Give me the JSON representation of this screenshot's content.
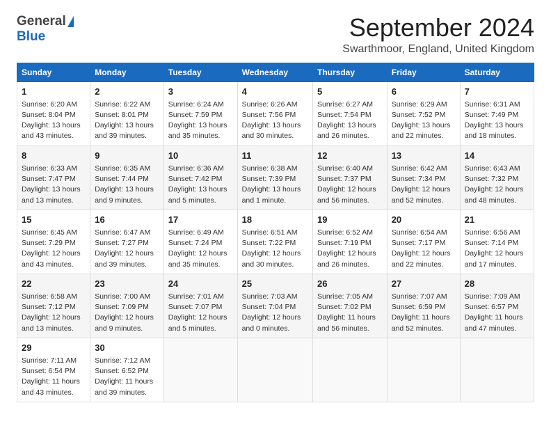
{
  "header": {
    "logo_general": "General",
    "logo_blue": "Blue",
    "month_title": "September 2024",
    "location": "Swarthmoor, England, United Kingdom"
  },
  "weekdays": [
    "Sunday",
    "Monday",
    "Tuesday",
    "Wednesday",
    "Thursday",
    "Friday",
    "Saturday"
  ],
  "weeks": [
    [
      {
        "day": "1",
        "sunrise": "Sunrise: 6:20 AM",
        "sunset": "Sunset: 8:04 PM",
        "daylight": "Daylight: 13 hours and 43 minutes."
      },
      {
        "day": "2",
        "sunrise": "Sunrise: 6:22 AM",
        "sunset": "Sunset: 8:01 PM",
        "daylight": "Daylight: 13 hours and 39 minutes."
      },
      {
        "day": "3",
        "sunrise": "Sunrise: 6:24 AM",
        "sunset": "Sunset: 7:59 PM",
        "daylight": "Daylight: 13 hours and 35 minutes."
      },
      {
        "day": "4",
        "sunrise": "Sunrise: 6:26 AM",
        "sunset": "Sunset: 7:56 PM",
        "daylight": "Daylight: 13 hours and 30 minutes."
      },
      {
        "day": "5",
        "sunrise": "Sunrise: 6:27 AM",
        "sunset": "Sunset: 7:54 PM",
        "daylight": "Daylight: 13 hours and 26 minutes."
      },
      {
        "day": "6",
        "sunrise": "Sunrise: 6:29 AM",
        "sunset": "Sunset: 7:52 PM",
        "daylight": "Daylight: 13 hours and 22 minutes."
      },
      {
        "day": "7",
        "sunrise": "Sunrise: 6:31 AM",
        "sunset": "Sunset: 7:49 PM",
        "daylight": "Daylight: 13 hours and 18 minutes."
      }
    ],
    [
      {
        "day": "8",
        "sunrise": "Sunrise: 6:33 AM",
        "sunset": "Sunset: 7:47 PM",
        "daylight": "Daylight: 13 hours and 13 minutes."
      },
      {
        "day": "9",
        "sunrise": "Sunrise: 6:35 AM",
        "sunset": "Sunset: 7:44 PM",
        "daylight": "Daylight: 13 hours and 9 minutes."
      },
      {
        "day": "10",
        "sunrise": "Sunrise: 6:36 AM",
        "sunset": "Sunset: 7:42 PM",
        "daylight": "Daylight: 13 hours and 5 minutes."
      },
      {
        "day": "11",
        "sunrise": "Sunrise: 6:38 AM",
        "sunset": "Sunset: 7:39 PM",
        "daylight": "Daylight: 13 hours and 1 minute."
      },
      {
        "day": "12",
        "sunrise": "Sunrise: 6:40 AM",
        "sunset": "Sunset: 7:37 PM",
        "daylight": "Daylight: 12 hours and 56 minutes."
      },
      {
        "day": "13",
        "sunrise": "Sunrise: 6:42 AM",
        "sunset": "Sunset: 7:34 PM",
        "daylight": "Daylight: 12 hours and 52 minutes."
      },
      {
        "day": "14",
        "sunrise": "Sunrise: 6:43 AM",
        "sunset": "Sunset: 7:32 PM",
        "daylight": "Daylight: 12 hours and 48 minutes."
      }
    ],
    [
      {
        "day": "15",
        "sunrise": "Sunrise: 6:45 AM",
        "sunset": "Sunset: 7:29 PM",
        "daylight": "Daylight: 12 hours and 43 minutes."
      },
      {
        "day": "16",
        "sunrise": "Sunrise: 6:47 AM",
        "sunset": "Sunset: 7:27 PM",
        "daylight": "Daylight: 12 hours and 39 minutes."
      },
      {
        "day": "17",
        "sunrise": "Sunrise: 6:49 AM",
        "sunset": "Sunset: 7:24 PM",
        "daylight": "Daylight: 12 hours and 35 minutes."
      },
      {
        "day": "18",
        "sunrise": "Sunrise: 6:51 AM",
        "sunset": "Sunset: 7:22 PM",
        "daylight": "Daylight: 12 hours and 30 minutes."
      },
      {
        "day": "19",
        "sunrise": "Sunrise: 6:52 AM",
        "sunset": "Sunset: 7:19 PM",
        "daylight": "Daylight: 12 hours and 26 minutes."
      },
      {
        "day": "20",
        "sunrise": "Sunrise: 6:54 AM",
        "sunset": "Sunset: 7:17 PM",
        "daylight": "Daylight: 12 hours and 22 minutes."
      },
      {
        "day": "21",
        "sunrise": "Sunrise: 6:56 AM",
        "sunset": "Sunset: 7:14 PM",
        "daylight": "Daylight: 12 hours and 17 minutes."
      }
    ],
    [
      {
        "day": "22",
        "sunrise": "Sunrise: 6:58 AM",
        "sunset": "Sunset: 7:12 PM",
        "daylight": "Daylight: 12 hours and 13 minutes."
      },
      {
        "day": "23",
        "sunrise": "Sunrise: 7:00 AM",
        "sunset": "Sunset: 7:09 PM",
        "daylight": "Daylight: 12 hours and 9 minutes."
      },
      {
        "day": "24",
        "sunrise": "Sunrise: 7:01 AM",
        "sunset": "Sunset: 7:07 PM",
        "daylight": "Daylight: 12 hours and 5 minutes."
      },
      {
        "day": "25",
        "sunrise": "Sunrise: 7:03 AM",
        "sunset": "Sunset: 7:04 PM",
        "daylight": "Daylight: 12 hours and 0 minutes."
      },
      {
        "day": "26",
        "sunrise": "Sunrise: 7:05 AM",
        "sunset": "Sunset: 7:02 PM",
        "daylight": "Daylight: 11 hours and 56 minutes."
      },
      {
        "day": "27",
        "sunrise": "Sunrise: 7:07 AM",
        "sunset": "Sunset: 6:59 PM",
        "daylight": "Daylight: 11 hours and 52 minutes."
      },
      {
        "day": "28",
        "sunrise": "Sunrise: 7:09 AM",
        "sunset": "Sunset: 6:57 PM",
        "daylight": "Daylight: 11 hours and 47 minutes."
      }
    ],
    [
      {
        "day": "29",
        "sunrise": "Sunrise: 7:11 AM",
        "sunset": "Sunset: 6:54 PM",
        "daylight": "Daylight: 11 hours and 43 minutes."
      },
      {
        "day": "30",
        "sunrise": "Sunrise: 7:12 AM",
        "sunset": "Sunset: 6:52 PM",
        "daylight": "Daylight: 11 hours and 39 minutes."
      },
      null,
      null,
      null,
      null,
      null
    ]
  ]
}
